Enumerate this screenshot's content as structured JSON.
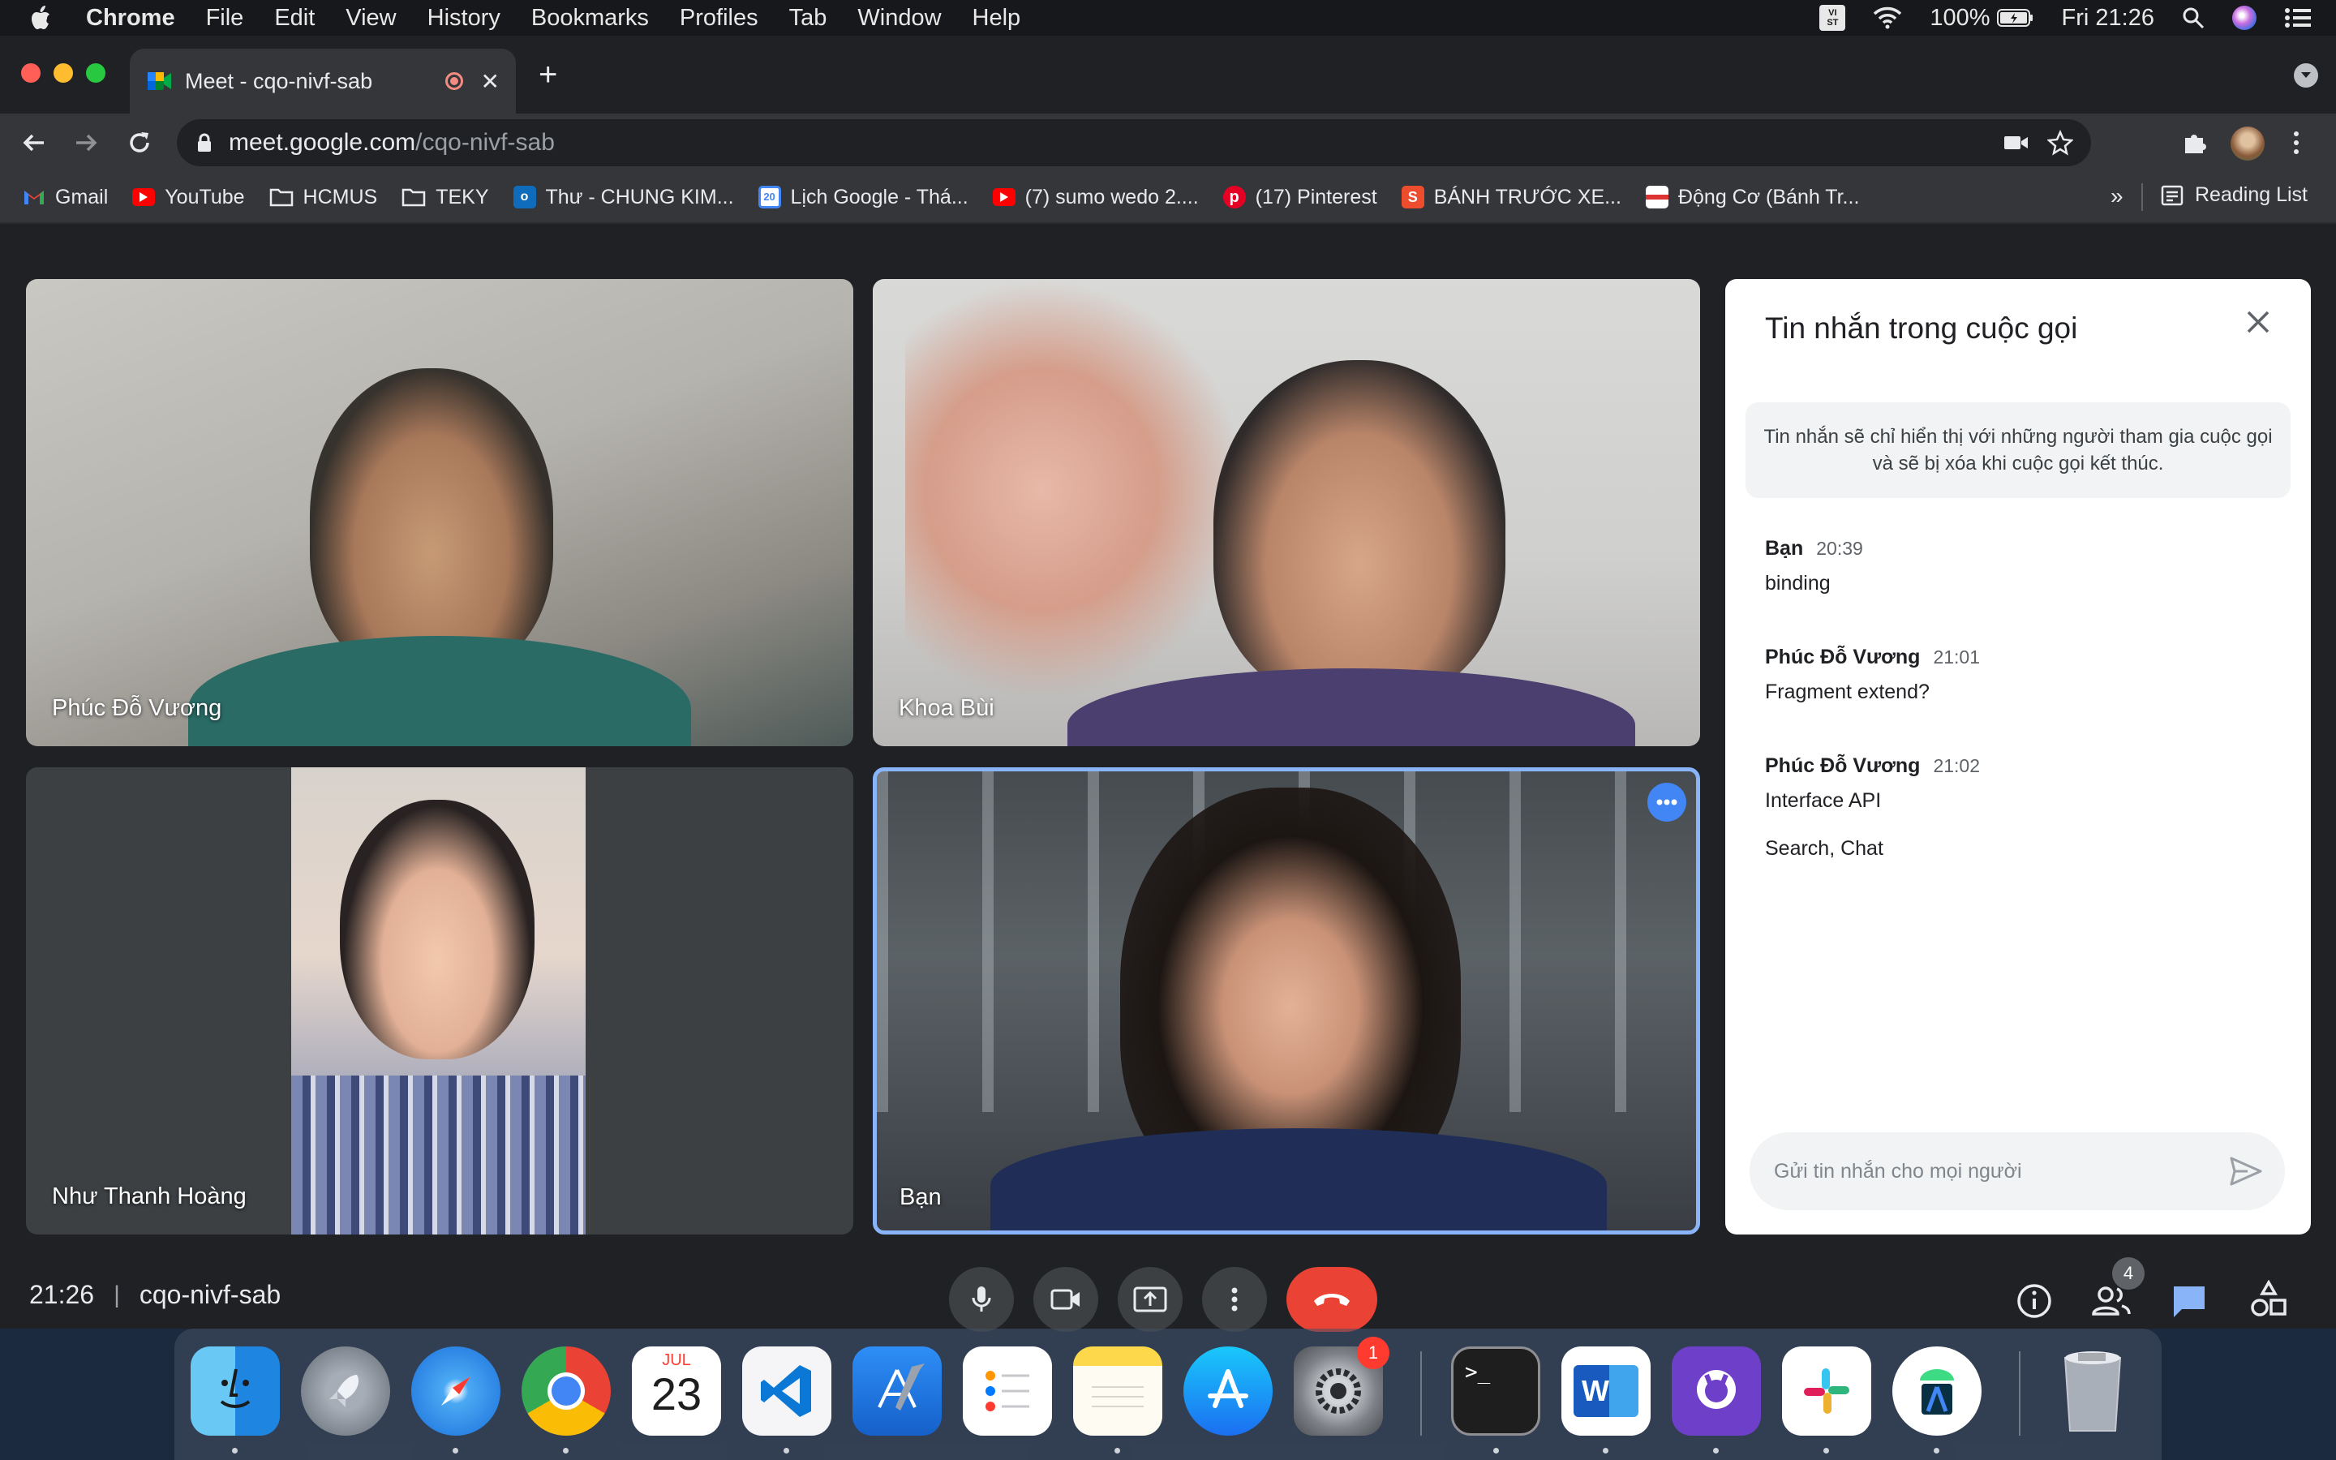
{
  "menubar": {
    "app": "Chrome",
    "items": [
      "File",
      "Edit",
      "View",
      "History",
      "Bookmarks",
      "Profiles",
      "Tab",
      "Window",
      "Help"
    ],
    "battery": "100%",
    "clock": "Fri 21:26",
    "input_badge": "VI ST"
  },
  "browser": {
    "tab_title": "Meet - cqo-nivf-sab",
    "url_host": "meet.google.com",
    "url_path": "/cqo-nivf-sab",
    "bookmarks": [
      {
        "label": "Gmail",
        "icon": "gmail-icon"
      },
      {
        "label": "YouTube",
        "icon": "youtube-icon"
      },
      {
        "label": "HCMUS",
        "icon": "folder-icon"
      },
      {
        "label": "TEKY",
        "icon": "folder-icon"
      },
      {
        "label": "Thư - CHUNG KIM...",
        "icon": "outlook-icon"
      },
      {
        "label": "Lịch Google - Thá...",
        "icon": "calendar-icon"
      },
      {
        "label": "(7) sumo wedo 2....",
        "icon": "youtube-icon"
      },
      {
        "label": "(17) Pinterest",
        "icon": "pinterest-icon"
      },
      {
        "label": "BÁNH TRƯỚC XE...",
        "icon": "shopee-icon"
      },
      {
        "label": "Động Cơ (Bánh Tr...",
        "icon": "page-icon"
      }
    ],
    "overflow": "»",
    "reading_list": "Reading List"
  },
  "participants": [
    {
      "name": "Phúc Đỗ Vương"
    },
    {
      "name": "Khoa Bùi"
    },
    {
      "name": "Như Thanh Hoàng"
    },
    {
      "name": "Bạn"
    }
  ],
  "chat": {
    "title": "Tin nhắn trong cuộc gọi",
    "notice": "Tin nhắn sẽ chỉ hiển thị với những người tham gia cuộc gọi và sẽ bị xóa khi cuộc gọi kết thúc.",
    "messages": [
      {
        "sender": "Bạn",
        "time": "20:39",
        "text": "binding",
        "extra": ""
      },
      {
        "sender": "Phúc Đỗ Vương",
        "time": "21:01",
        "text": "Fragment extend?",
        "extra": ""
      },
      {
        "sender": "Phúc Đỗ Vương",
        "time": "21:02",
        "text": "Interface API",
        "extra": "Search, Chat"
      }
    ],
    "input_placeholder": "Gửi tin nhắn cho mọi người"
  },
  "meeting": {
    "time": "21:26",
    "separator": "|",
    "code": "cqo-nivf-sab",
    "people_count": "4"
  },
  "dock": {
    "calendar_month": "JUL",
    "calendar_day": "23",
    "settings_badge": "1",
    "terminal_prompt": ">_",
    "word_letter": "W"
  },
  "colors": {
    "end_call": "#ea4335",
    "active_border": "#8ab4f8",
    "chat_icon": "#8ab4f8"
  }
}
